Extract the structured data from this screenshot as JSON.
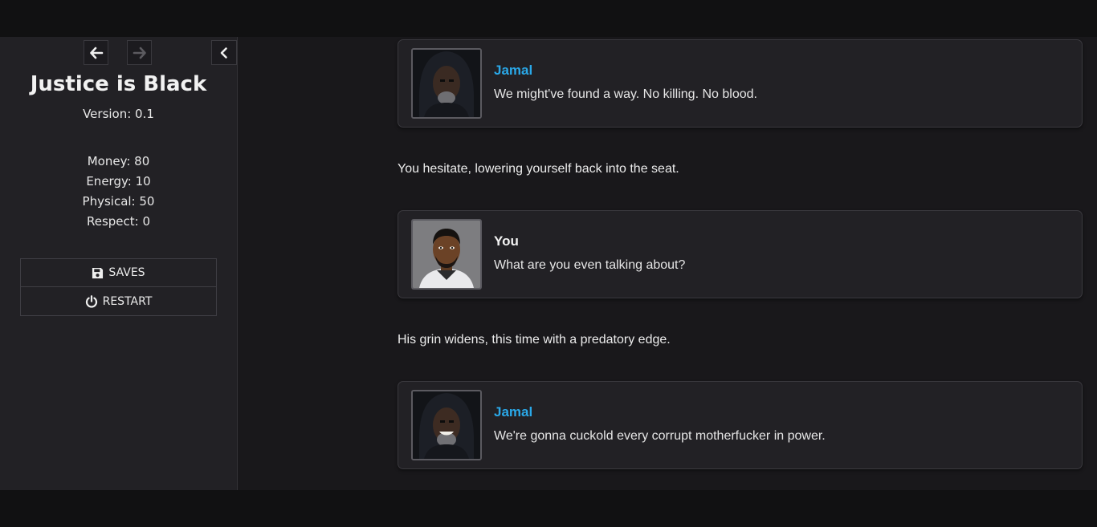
{
  "header": {
    "back_icon": "arrow-left-icon",
    "forward_icon": "arrow-right-icon",
    "collapse_icon": "chevron-left-icon"
  },
  "sidebar": {
    "title": "Justice is Black",
    "version": "Version: 0.1",
    "stats": [
      "Money: 80",
      "Energy: 10",
      "Physical: 50",
      "Respect: 0"
    ],
    "menu": [
      {
        "label": "SAVES",
        "icon": "save-icon"
      },
      {
        "label": "RESTART",
        "icon": "power-icon"
      }
    ]
  },
  "passage": {
    "blocks": [
      {
        "type": "dialog",
        "speaker": "Jamal",
        "text": "We might've found a way. No killing. No blood.",
        "portrait": "jamal-portrait"
      },
      {
        "type": "narration",
        "text": "You hesitate, lowering yourself back into the seat."
      },
      {
        "type": "dialog",
        "speaker": "You",
        "text": "What are you even talking about?",
        "portrait": "player-portrait"
      },
      {
        "type": "narration",
        "text": "His grin widens, this time with a predatory edge."
      },
      {
        "type": "dialog",
        "speaker": "Jamal",
        "text": "We're gonna cuckold every corrupt motherfucker in power.",
        "portrait": "jamal-portrait"
      }
    ]
  },
  "colors": {
    "jamal_name": "#2aa8e8",
    "player_name": "#f2f2f2",
    "sidebar_bg": "#222125",
    "main_bg": "#19181b"
  }
}
